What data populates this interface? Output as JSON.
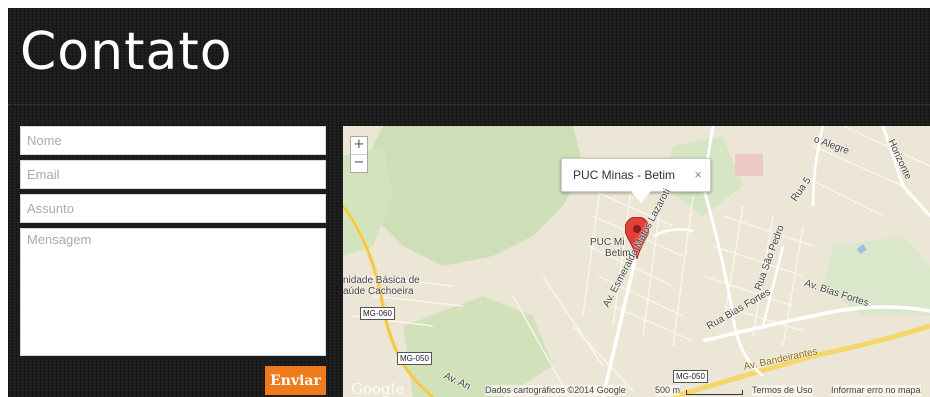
{
  "page": {
    "title": "Contato"
  },
  "form": {
    "name_placeholder": "Nome",
    "email_placeholder": "Email",
    "subject_placeholder": "Assunto",
    "message_placeholder": "Mensagem",
    "submit_label": "Enviar"
  },
  "map": {
    "zoom_in": "+",
    "zoom_out": "−",
    "info_title": "PUC Minas - Betim",
    "info_close": "×",
    "labels": {
      "puc_1": "PUC Mi",
      "puc_2": "Betim",
      "unidade_1": "nidade Básica de",
      "unidade_2": "aúde Cachoeira",
      "av_bias_fortes": "Av. Bias Fortes",
      "rua_bias_fortes": "Rua Bias Fortes",
      "av_bandeirantes": "Av. Bandeirantes",
      "av_esmeralda": "Av. Esmeralda Matos Lazaroti",
      "av_an": "Av. An",
      "rua_sao_pedro": "Rua São Pedro",
      "rua_5": "Rua 5",
      "alegre": "o Alegre",
      "horizonte": "Horizonte",
      "mg060": "MG-060",
      "mg050_a": "MG-050",
      "mg050_b": "MG-050"
    },
    "footer": {
      "google": "Google",
      "map_data": "Dados cartográficos ©2014 Google",
      "scale": "500 m",
      "terms": "Termos de Uso",
      "report": "Informar erro no mapa"
    }
  }
}
